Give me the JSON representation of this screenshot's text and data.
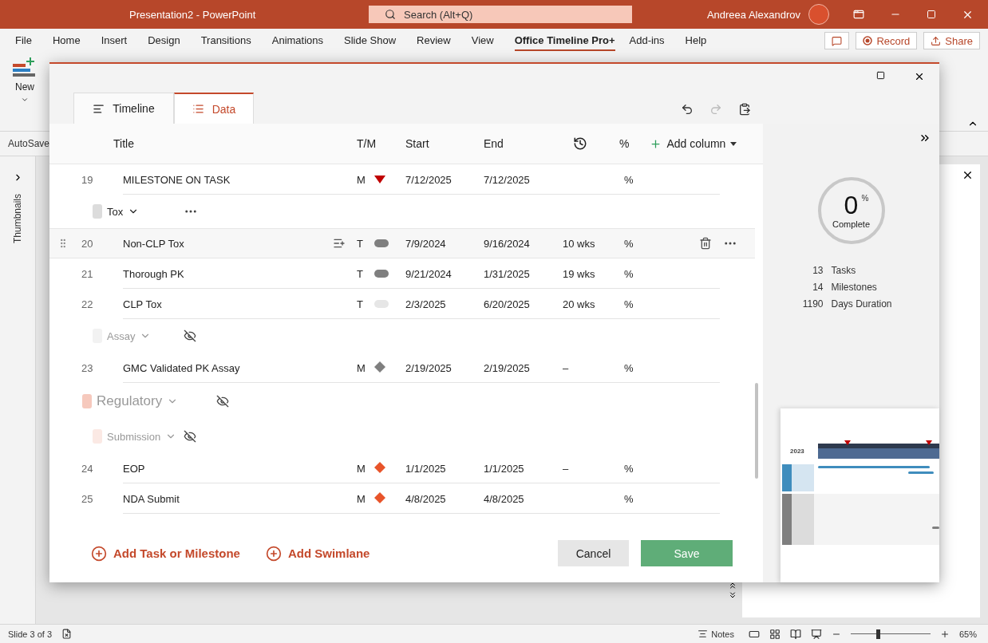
{
  "app": {
    "title": "Presentation2  -  PowerPoint",
    "search": {
      "placeholder": "Search (Alt+Q)"
    },
    "user": "Andreea Alexandrov"
  },
  "ribbon": {
    "tabs": [
      {
        "label": "File",
        "selected": false
      },
      {
        "label": "Home",
        "selected": false
      },
      {
        "label": "Insert",
        "selected": false
      },
      {
        "label": "Design",
        "selected": false
      },
      {
        "label": "Transitions",
        "selected": false
      },
      {
        "label": "Animations",
        "selected": false
      },
      {
        "label": "Slide Show",
        "selected": false
      },
      {
        "label": "Review",
        "selected": false
      },
      {
        "label": "View",
        "selected": false
      },
      {
        "label": "Office Timeline Pro+",
        "selected": true
      },
      {
        "label": "Add-ins",
        "selected": false
      },
      {
        "label": "Help",
        "selected": false
      }
    ],
    "record": "Record",
    "share": "Share",
    "new_button": "New",
    "autosave": "AutoSave"
  },
  "thumbnails": {
    "label": "Thumbnails"
  },
  "dialog": {
    "tabs": [
      {
        "label": "Timeline",
        "kind": "timeline",
        "selected": false
      },
      {
        "label": "Data",
        "kind": "data",
        "selected": true
      }
    ],
    "columns": {
      "title": "Title",
      "type": "T/M",
      "start": "Start",
      "end": "End",
      "percent": "%",
      "add": "Add column"
    },
    "items": [
      {
        "kind": "task_milestone",
        "number": "19",
        "title": "MILESTONE ON TASK",
        "type": "M",
        "color": "#c00000",
        "start": "7/12/2025",
        "end": "7/12/2025",
        "percent": "%",
        "highlighted": false
      },
      {
        "kind": "group",
        "label": "Tox",
        "color": "#dcdcdc",
        "hidden": false
      },
      {
        "kind": "task",
        "number": "20",
        "title": "Non-CLP Tox",
        "type": "T",
        "color": "#7f7f7f",
        "start": "7/9/2024",
        "end": "9/16/2024",
        "duration": "10 wks",
        "percent": "%",
        "highlighted": true
      },
      {
        "kind": "task",
        "number": "21",
        "title": "Thorough PK",
        "type": "T",
        "color": "#7f7f7f",
        "start": "9/21/2024",
        "end": "1/31/2025",
        "duration": "19 wks",
        "percent": "%",
        "highlighted": false
      },
      {
        "kind": "task",
        "number": "22",
        "title": "CLP Tox",
        "type": "T",
        "color": "#e6e6e6",
        "start": "2/3/2025",
        "end": "6/20/2025",
        "duration": "20 wks",
        "percent": "%",
        "highlighted": false
      },
      {
        "kind": "group",
        "label": "Assay",
        "color": "#f2f2f2",
        "hidden": true
      },
      {
        "kind": "milestone",
        "number": "23",
        "title": "GMC Validated PK Assay",
        "type": "M",
        "color": "#7f7f7f",
        "start": "2/19/2025",
        "end": "2/19/2025",
        "duration": "–",
        "percent": "%",
        "highlighted": false
      },
      {
        "kind": "swimlane",
        "label": "Regulatory",
        "color": "#f6c9bd",
        "hidden": true
      },
      {
        "kind": "group",
        "label": "Submission",
        "color": "#fbe9e4",
        "hidden": true
      },
      {
        "kind": "milestone",
        "number": "24",
        "title": "EOP",
        "type": "M",
        "color": "#e8542a",
        "start": "1/1/2025",
        "end": "1/1/2025",
        "duration": "–",
        "percent": "%",
        "highlighted": false
      },
      {
        "kind": "milestone",
        "number": "25",
        "title": "NDA Submit",
        "type": "M",
        "color": "#e8542a",
        "start": "4/8/2025",
        "end": "4/8/2025",
        "percent": "%",
        "highlighted": false
      }
    ],
    "add_task": "Add Task or Milestone",
    "add_swimlane": "Add Swimlane",
    "cancel": "Cancel",
    "save": "Save",
    "stats": {
      "progress": {
        "value": "0",
        "unit": "%",
        "label": "Complete"
      },
      "lines": [
        {
          "value": "13",
          "label": "Tasks"
        },
        {
          "value": "14",
          "label": "Milestones"
        },
        {
          "value": "1190",
          "label": "Days Duration"
        }
      ]
    },
    "preview": {
      "year_label": "2023"
    }
  },
  "status_bar": {
    "slide": "Slide 3 of 3",
    "notes": "Notes",
    "zoom": {
      "level": 0.32,
      "reading": "65%"
    }
  }
}
